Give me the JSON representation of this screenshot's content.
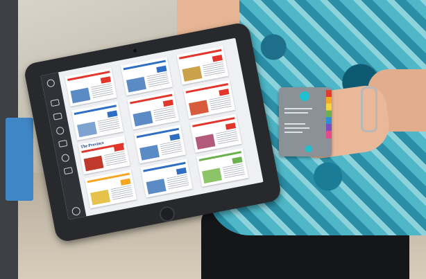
{
  "scene": {
    "subject": "tablet",
    "card_colors": [
      "#e23b2e",
      "#f5a623",
      "#f6d43a",
      "#6ab04c",
      "#2e8fd6",
      "#7c4dbd",
      "#e64a8a"
    ],
    "accent": "#1ec1cf"
  },
  "tablet": {
    "sidebar_icons": [
      "menu-icon",
      "library-icon",
      "bookmark-icon",
      "download-icon",
      "settings-icon",
      "share-icon",
      "user-icon",
      "home-icon"
    ],
    "papers": [
      {
        "masthead": "",
        "accent": "#e2362d",
        "block": "#5b8bc4"
      },
      {
        "masthead": "",
        "accent": "#2e6fc4",
        "block": "#5b8bc4"
      },
      {
        "masthead": "",
        "accent": "#e2362d",
        "block": "#c9a24a"
      },
      {
        "masthead": "",
        "accent": "#2e6fc4",
        "block": "#7fa3d1"
      },
      {
        "masthead": "",
        "accent": "#e2362d",
        "block": "#5b8bc4"
      },
      {
        "masthead": "",
        "accent": "#e2362d",
        "block": "#d85c3b"
      },
      {
        "masthead": "The Province",
        "accent": "#e2362d",
        "block": "#c0392b"
      },
      {
        "masthead": "",
        "accent": "#2e6fc4",
        "block": "#5b8bc4"
      },
      {
        "masthead": "",
        "accent": "#e2362d",
        "block": "#b35a7a"
      },
      {
        "masthead": "",
        "accent": "#f5a623",
        "block": "#e5c34a"
      },
      {
        "masthead": "",
        "accent": "#2e6fc4",
        "block": "#5b8bc4"
      },
      {
        "masthead": "",
        "accent": "#6ab04c",
        "block": "#8cc46a"
      }
    ]
  }
}
